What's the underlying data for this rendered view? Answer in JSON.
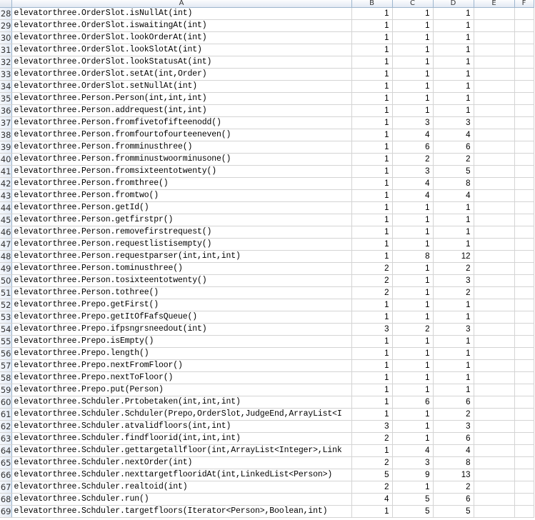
{
  "columns": [
    "A",
    "B",
    "C",
    "D",
    "E",
    "F"
  ],
  "rows": [
    {
      "row": "28",
      "name": "elevatorthree.OrderSlot.isNullAt(int)",
      "b": "1",
      "c": "1",
      "d": "1"
    },
    {
      "row": "29",
      "name": "elevatorthree.OrderSlot.iswaitingAt(int)",
      "b": "1",
      "c": "1",
      "d": "1"
    },
    {
      "row": "30",
      "name": "elevatorthree.OrderSlot.lookOrderAt(int)",
      "b": "1",
      "c": "1",
      "d": "1"
    },
    {
      "row": "31",
      "name": "elevatorthree.OrderSlot.lookSlotAt(int)",
      "b": "1",
      "c": "1",
      "d": "1"
    },
    {
      "row": "32",
      "name": "elevatorthree.OrderSlot.lookStatusAt(int)",
      "b": "1",
      "c": "1",
      "d": "1"
    },
    {
      "row": "33",
      "name": "elevatorthree.OrderSlot.setAt(int,Order)",
      "b": "1",
      "c": "1",
      "d": "1"
    },
    {
      "row": "34",
      "name": "elevatorthree.OrderSlot.setNullAt(int)",
      "b": "1",
      "c": "1",
      "d": "1"
    },
    {
      "row": "35",
      "name": "elevatorthree.Person.Person(int,int,int)",
      "b": "1",
      "c": "1",
      "d": "1"
    },
    {
      "row": "36",
      "name": "elevatorthree.Person.addrequest(int,int)",
      "b": "1",
      "c": "1",
      "d": "1"
    },
    {
      "row": "37",
      "name": "elevatorthree.Person.fromfivetofifteenodd()",
      "b": "1",
      "c": "3",
      "d": "3"
    },
    {
      "row": "38",
      "name": "elevatorthree.Person.fromfourtofourteeneven()",
      "b": "1",
      "c": "4",
      "d": "4"
    },
    {
      "row": "39",
      "name": "elevatorthree.Person.fromminusthree()",
      "b": "1",
      "c": "6",
      "d": "6"
    },
    {
      "row": "40",
      "name": "elevatorthree.Person.fromminustwoorminusone()",
      "b": "1",
      "c": "2",
      "d": "2"
    },
    {
      "row": "41",
      "name": "elevatorthree.Person.fromsixteentotwenty()",
      "b": "1",
      "c": "3",
      "d": "5"
    },
    {
      "row": "42",
      "name": "elevatorthree.Person.fromthree()",
      "b": "1",
      "c": "4",
      "d": "8"
    },
    {
      "row": "43",
      "name": "elevatorthree.Person.fromtwo()",
      "b": "1",
      "c": "4",
      "d": "4"
    },
    {
      "row": "44",
      "name": "elevatorthree.Person.getId()",
      "b": "1",
      "c": "1",
      "d": "1"
    },
    {
      "row": "45",
      "name": "elevatorthree.Person.getfirstpr()",
      "b": "1",
      "c": "1",
      "d": "1"
    },
    {
      "row": "46",
      "name": "elevatorthree.Person.removefirstrequest()",
      "b": "1",
      "c": "1",
      "d": "1"
    },
    {
      "row": "47",
      "name": "elevatorthree.Person.requestlistisempty()",
      "b": "1",
      "c": "1",
      "d": "1"
    },
    {
      "row": "48",
      "name": "elevatorthree.Person.requestparser(int,int,int)",
      "b": "1",
      "c": "8",
      "d": "12"
    },
    {
      "row": "49",
      "name": "elevatorthree.Person.tominusthree()",
      "b": "2",
      "c": "1",
      "d": "2"
    },
    {
      "row": "50",
      "name": "elevatorthree.Person.tosixteentotwenty()",
      "b": "2",
      "c": "1",
      "d": "3"
    },
    {
      "row": "51",
      "name": "elevatorthree.Person.tothree()",
      "b": "2",
      "c": "1",
      "d": "2"
    },
    {
      "row": "52",
      "name": "elevatorthree.Prepo.getFirst()",
      "b": "1",
      "c": "1",
      "d": "1"
    },
    {
      "row": "53",
      "name": "elevatorthree.Prepo.getItOfFafsQueue()",
      "b": "1",
      "c": "1",
      "d": "1"
    },
    {
      "row": "54",
      "name": "elevatorthree.Prepo.ifpsngrsneedout(int)",
      "b": "3",
      "c": "2",
      "d": "3"
    },
    {
      "row": "55",
      "name": "elevatorthree.Prepo.isEmpty()",
      "b": "1",
      "c": "1",
      "d": "1"
    },
    {
      "row": "56",
      "name": "elevatorthree.Prepo.length()",
      "b": "1",
      "c": "1",
      "d": "1"
    },
    {
      "row": "57",
      "name": "elevatorthree.Prepo.nextFromFloor()",
      "b": "1",
      "c": "1",
      "d": "1"
    },
    {
      "row": "58",
      "name": "elevatorthree.Prepo.nextToFloor()",
      "b": "1",
      "c": "1",
      "d": "1"
    },
    {
      "row": "59",
      "name": "elevatorthree.Prepo.put(Person)",
      "b": "1",
      "c": "1",
      "d": "1"
    },
    {
      "row": "60",
      "name": "elevatorthree.Schduler.Prtobetaken(int,int,int)",
      "b": "1",
      "c": "6",
      "d": "6"
    },
    {
      "row": "61",
      "name": "elevatorthree.Schduler.Schduler(Prepo,OrderSlot,JudgeEnd,ArrayList<I",
      "b": "1",
      "c": "1",
      "d": "2"
    },
    {
      "row": "62",
      "name": "elevatorthree.Schduler.atvalidfloors(int,int)",
      "b": "3",
      "c": "1",
      "d": "3"
    },
    {
      "row": "63",
      "name": "elevatorthree.Schduler.findfloorid(int,int,int)",
      "b": "2",
      "c": "1",
      "d": "6"
    },
    {
      "row": "64",
      "name": "elevatorthree.Schduler.gettargetallfloor(int,ArrayList<Integer>,Link",
      "b": "1",
      "c": "4",
      "d": "4"
    },
    {
      "row": "65",
      "name": "elevatorthree.Schduler.nextOrder(int)",
      "b": "2",
      "c": "3",
      "d": "8"
    },
    {
      "row": "66",
      "name": "elevatorthree.Schduler.nexttargetflooridAt(int,LinkedList<Person>)",
      "b": "5",
      "c": "9",
      "d": "13"
    },
    {
      "row": "67",
      "name": "elevatorthree.Schduler.realtoid(int)",
      "b": "2",
      "c": "1",
      "d": "2"
    },
    {
      "row": "68",
      "name": "elevatorthree.Schduler.run()",
      "b": "4",
      "c": "5",
      "d": "6"
    },
    {
      "row": "69",
      "name": "elevatorthree.Schduler.targetfloors(Iterator<Person>,Boolean,int)",
      "b": "1",
      "c": "5",
      "d": "5"
    }
  ]
}
